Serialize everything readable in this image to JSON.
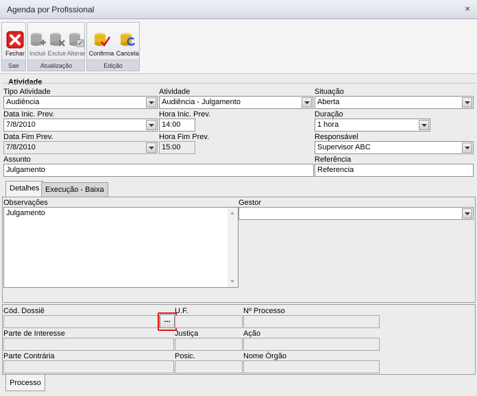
{
  "window": {
    "title": "Agenda por Profissional",
    "close_glyph": "×"
  },
  "ribbon": {
    "groups": [
      {
        "label": "Sair",
        "buttons": [
          {
            "label": "Fechar",
            "icon": "close-red-x-icon"
          }
        ]
      },
      {
        "label": "Atualização",
        "buttons": [
          {
            "label": "Incluir",
            "icon": "db-add-icon"
          },
          {
            "label": "Excluir",
            "icon": "db-delete-icon"
          },
          {
            "label": "Alterar",
            "icon": "db-edit-icon"
          }
        ]
      },
      {
        "label": "Edição",
        "buttons": [
          {
            "label": "Confirma",
            "icon": "db-confirm-icon"
          },
          {
            "label": "Cancela",
            "icon": "db-cancel-icon"
          }
        ]
      }
    ]
  },
  "atividade": {
    "section_title": "Atividade",
    "tipo_atividade": {
      "label": "Tipo Atividade",
      "value": "Audiência"
    },
    "atividade": {
      "label": "Atividade",
      "value": "Audiência - Julgamento"
    },
    "situacao": {
      "label": "Situação",
      "value": "Aberta"
    },
    "data_inic_prev": {
      "label": "Data Inic. Prev.",
      "value": "7/8/2010"
    },
    "hora_inic_prev": {
      "label": "Hora Inic. Prev.",
      "value": "14:00"
    },
    "duracao": {
      "label": "Duração",
      "value": "1 hora"
    },
    "data_fim_prev": {
      "label": "Data Fim Prev.",
      "value": "7/8/2010"
    },
    "hora_fim_prev": {
      "label": "Hora Fim Prev.",
      "value": "15:00"
    },
    "responsavel": {
      "label": "Responsável",
      "value": "Supervisor ABC"
    },
    "assunto": {
      "label": "Assunto",
      "value": "Julgamento"
    },
    "referencia": {
      "label": "Referência",
      "value": "Referencia"
    }
  },
  "tabs": [
    {
      "label": "Detalhes"
    },
    {
      "label": "Execução - Baixa"
    }
  ],
  "detalhes": {
    "observacoes": {
      "label": "Observações",
      "value": "Julgamento"
    },
    "gestor": {
      "label": "Gestor",
      "value": ""
    }
  },
  "processo": {
    "cod_dossie": {
      "label": "Cód. Dossiê",
      "value": ""
    },
    "ellipsis": "...",
    "uf": {
      "label": "U.F.",
      "value": ""
    },
    "n_processo": {
      "label": "Nº Processo",
      "value": ""
    },
    "parte_interesse": {
      "label": "Parte de Interesse",
      "value": ""
    },
    "justica": {
      "label": "Justiça",
      "value": ""
    },
    "acao": {
      "label": "Ação",
      "value": ""
    },
    "parte_contraria": {
      "label": "Parte Contrária",
      "value": ""
    },
    "posic": {
      "label": "Posic.",
      "value": ""
    },
    "nome_orgao": {
      "label": "Nome Órgão",
      "value": ""
    },
    "tab_label": "Processo"
  },
  "colors": {
    "highlight": "#e01818",
    "title_bg": "#d9dce6"
  }
}
